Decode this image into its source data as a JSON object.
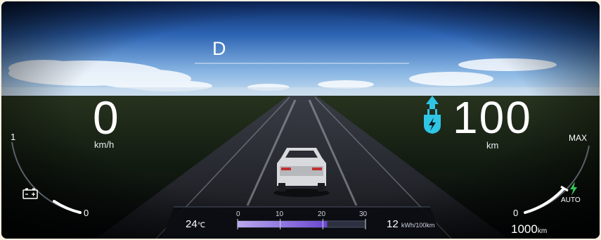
{
  "gear": "D",
  "speed": {
    "value": "0",
    "unit": "km/h"
  },
  "range": {
    "value": "100",
    "unit": "km"
  },
  "left_gauge": {
    "max_label": "1",
    "min_label": "0"
  },
  "right_gauge": {
    "max_label": "MAX",
    "min_label": "0",
    "mode_label": "AUTO"
  },
  "odometer": {
    "value": "1000",
    "unit": "km"
  },
  "temperature": {
    "value": "24",
    "unit": "℃"
  },
  "efficiency": {
    "value": "12",
    "unit": "kWh/100km",
    "scale": [
      "0",
      "10",
      "20",
      "30"
    ],
    "level_kwh": 21
  },
  "icons": [
    "battery-icon",
    "charge-plug-icon",
    "charging-bolt-icon"
  ],
  "colors": {
    "accent_cyan": "#2fc6e6",
    "charge_green": "#35c85a",
    "bar_purple": "#7c5ed8"
  }
}
